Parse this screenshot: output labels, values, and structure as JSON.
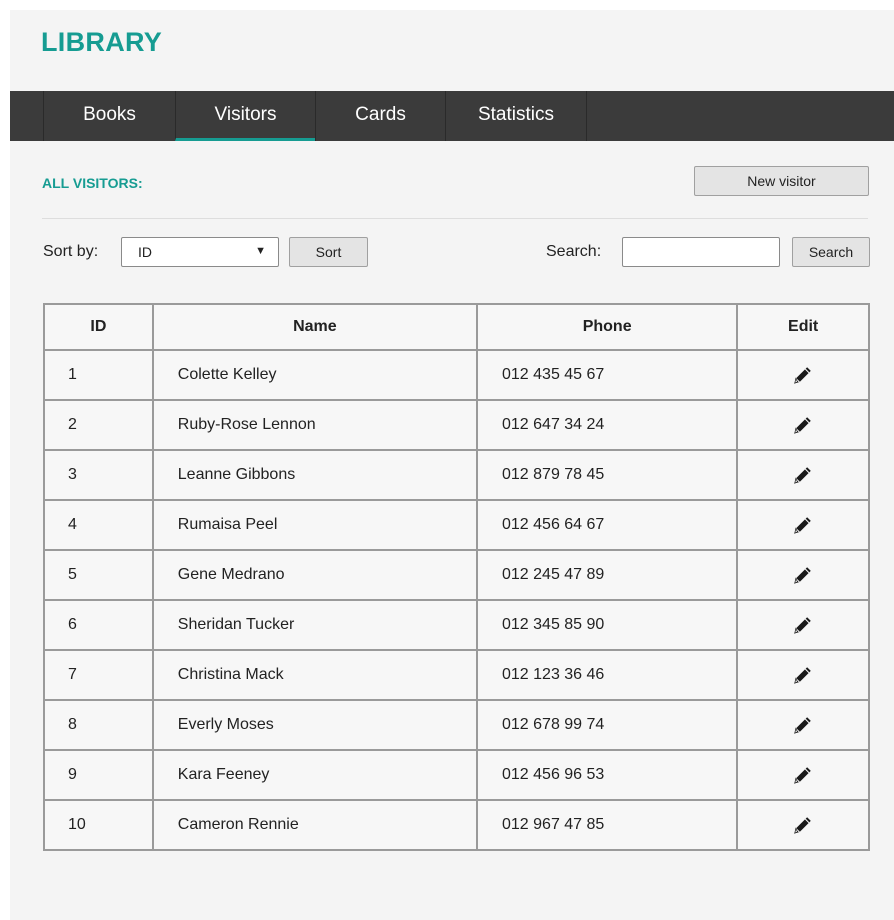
{
  "app": {
    "brand": "LIBRARY"
  },
  "nav": {
    "tabs": [
      {
        "label": "Books",
        "active": false
      },
      {
        "label": "Visitors",
        "active": true
      },
      {
        "label": "Cards",
        "active": false
      },
      {
        "label": "Statistics",
        "active": false
      }
    ]
  },
  "colors": {
    "accent": "#169c92",
    "navbar": "#3b3b3b",
    "background": "#f4f4f4"
  },
  "section": {
    "title": "ALL VISITORS:",
    "new_button": "New visitor"
  },
  "controls": {
    "sort_label": "Sort by:",
    "sort_value": "ID",
    "sort_button": "Sort",
    "search_label": "Search:",
    "search_value": "",
    "search_placeholder": "",
    "search_button": "Search"
  },
  "table": {
    "headers": [
      "ID",
      "Name",
      "Phone",
      "Edit"
    ],
    "edit_icon": "pencil-icon",
    "rows": [
      {
        "id": "1",
        "name": "Colette Kelley",
        "phone": "012 435 45 67"
      },
      {
        "id": "2",
        "name": "Ruby-Rose Lennon",
        "phone": "012 647 34 24"
      },
      {
        "id": "3",
        "name": "Leanne Gibbons",
        "phone": "012 879 78 45"
      },
      {
        "id": "4",
        "name": "Rumaisa Peel",
        "phone": "012 456 64 67"
      },
      {
        "id": "5",
        "name": "Gene Medrano",
        "phone": "012 245 47 89"
      },
      {
        "id": "6",
        "name": "Sheridan Tucker",
        "phone": "012 345 85 90"
      },
      {
        "id": "7",
        "name": "Christina Mack",
        "phone": "012 123 36 46"
      },
      {
        "id": "8",
        "name": "Everly Moses",
        "phone": "012 678 99 74"
      },
      {
        "id": "9",
        "name": "Kara Feeney",
        "phone": "012 456 96 53"
      },
      {
        "id": "10",
        "name": "Cameron Rennie",
        "phone": "012 967 47 85"
      }
    ]
  }
}
